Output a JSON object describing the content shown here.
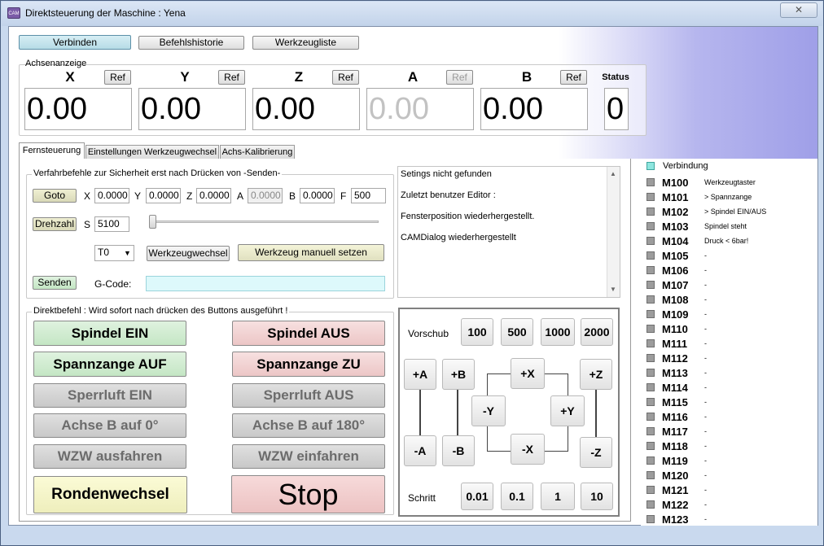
{
  "window": {
    "title": "Direktsteuerung der Maschine : Yena",
    "close_symbol": "✕"
  },
  "top_buttons": {
    "connect": "Verbinden",
    "history": "Befehlshistorie",
    "tools": "Werkzeugliste"
  },
  "axes": {
    "group_label": "Achsenanzeige",
    "ref_label": "Ref",
    "items": [
      {
        "name": "X",
        "value": "0.00",
        "enabled": true
      },
      {
        "name": "Y",
        "value": "0.00",
        "enabled": true
      },
      {
        "name": "Z",
        "value": "0.00",
        "enabled": true
      },
      {
        "name": "A",
        "value": "0.00",
        "enabled": false
      },
      {
        "name": "B",
        "value": "0.00",
        "enabled": true
      }
    ],
    "status_label": "Status",
    "status_value": "0"
  },
  "tabs": [
    "Fernsteuerung",
    "Einstellungen Werkzeugwechsel",
    "Achs-Kalibrierung"
  ],
  "remote": {
    "group_label": "Verfahrbefehle zur Sicherheit erst nach Drücken von -Senden-",
    "goto_label": "Goto",
    "fields": [
      {
        "label": "X",
        "value": "0.0000"
      },
      {
        "label": "Y",
        "value": "0.0000"
      },
      {
        "label": "Z",
        "value": "0.0000"
      },
      {
        "label": "A",
        "value": "0.0000"
      },
      {
        "label": "B",
        "value": "0.0000"
      },
      {
        "label": "F",
        "value": "500"
      }
    ],
    "speed_label": "Drehzahl",
    "speed_prefix": "S",
    "speed_value": "5100",
    "speed_fraction": 0.0,
    "tool_select": "T0",
    "dropdown_symbol": "▼",
    "tool_change": "Werkzeugwechsel",
    "tool_manual": "Werkzeug manuell setzen",
    "send_label": "Senden",
    "gcode_label": "G-Code:",
    "gcode_value": ""
  },
  "log": {
    "lines": [
      "Setings nicht gefunden",
      "Zuletzt benutzer Editor :",
      "Fensterposition wiederhergestellt.",
      "CAMDialog wiederhergestellt"
    ],
    "arrow_up": "▲",
    "arrow_down": "▼"
  },
  "direct": {
    "group_label": "Direktbefehl : Wird sofort nach drücken des Buttons ausgeführt !",
    "buttons": {
      "spindle_on": "Spindel EIN",
      "spindle_off": "Spindel AUS",
      "collet_open": "Spannzange AUF",
      "collet_close": "Spannzange ZU",
      "air_on": "Sperrluft EIN",
      "air_off": "Sperrluft AUS",
      "b_zero": "Achse B auf 0°",
      "b_180": "Achse B auf 180°",
      "wzw_out": "WZW ausfahren",
      "wzw_in": "WZW einfahren",
      "round_change": "Rondenwechsel",
      "stop": "Stop"
    }
  },
  "jog": {
    "feed_label": "Vorschub",
    "feeds": [
      "100",
      "500",
      "1000",
      "2000"
    ],
    "step_label": "Schritt",
    "steps": [
      "0.01",
      "0.1",
      "1",
      "10"
    ],
    "axis_buttons": {
      "plus_a": "+A",
      "minus_a": "-A",
      "plus_b": "+B",
      "minus_b": "-B",
      "plus_x": "+X",
      "minus_x": "-X",
      "plus_y": "+Y",
      "minus_y": "-Y",
      "plus_z": "+Z",
      "minus_z": "-Z"
    }
  },
  "status_panel": {
    "connection": "Verbindung",
    "connection_color": "#8ee6df",
    "m_codes": [
      {
        "code": "M100",
        "desc": "Werkzeugtaster"
      },
      {
        "code": "M101",
        "desc": "> Spannzange"
      },
      {
        "code": "M102",
        "desc": "> Spindel EIN/AUS"
      },
      {
        "code": "M103",
        "desc": "Spindel steht"
      },
      {
        "code": "M104",
        "desc": "Druck < 6bar!"
      },
      {
        "code": "M105",
        "desc": "-"
      },
      {
        "code": "M106",
        "desc": "-"
      },
      {
        "code": "M107",
        "desc": "-"
      },
      {
        "code": "M108",
        "desc": "-"
      },
      {
        "code": "M109",
        "desc": "-"
      },
      {
        "code": "M110",
        "desc": "-"
      },
      {
        "code": "M111",
        "desc": "-"
      },
      {
        "code": "M112",
        "desc": "-"
      },
      {
        "code": "M113",
        "desc": "-"
      },
      {
        "code": "M114",
        "desc": "-"
      },
      {
        "code": "M115",
        "desc": "-"
      },
      {
        "code": "M116",
        "desc": "-"
      },
      {
        "code": "M117",
        "desc": "-"
      },
      {
        "code": "M118",
        "desc": "-"
      },
      {
        "code": "M119",
        "desc": "-"
      },
      {
        "code": "M120",
        "desc": "-"
      },
      {
        "code": "M121",
        "desc": "-"
      },
      {
        "code": "M122",
        "desc": "-"
      },
      {
        "code": "M123",
        "desc": "-"
      }
    ]
  }
}
